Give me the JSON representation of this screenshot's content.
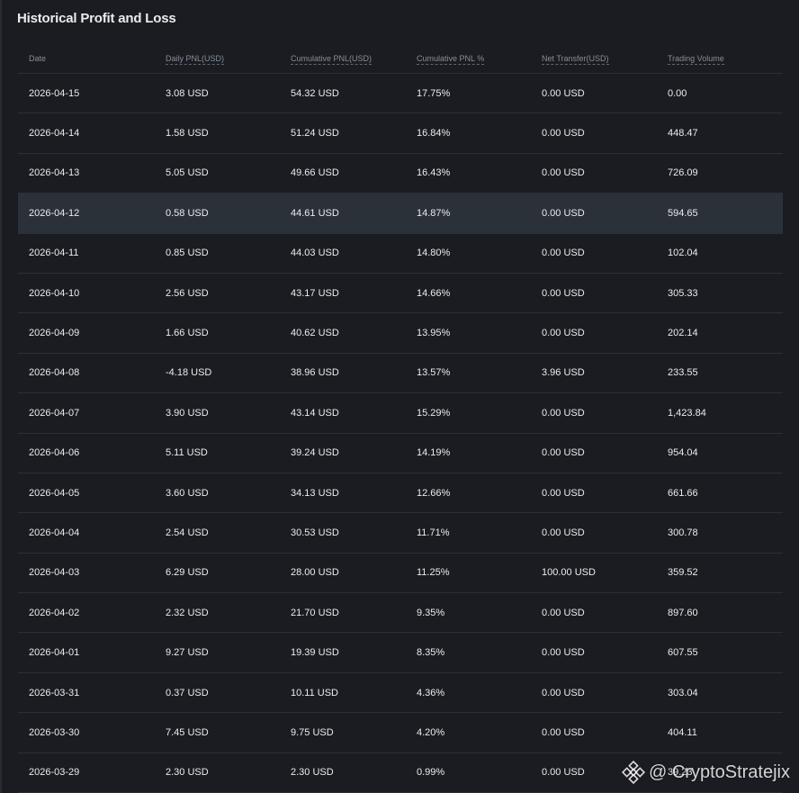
{
  "title": "Historical Profit and Loss",
  "columns": [
    "Date",
    "Daily PNL(USD)",
    "Cumulative PNL(USD)",
    "Cumulative PNL %",
    "Net Transfer(USD)",
    "Trading Volume"
  ],
  "rows": [
    [
      "2026-04-15",
      "3.08 USD",
      "54.32 USD",
      "17.75%",
      "0.00 USD",
      "0.00"
    ],
    [
      "2026-04-14",
      "1.58 USD",
      "51.24 USD",
      "16.84%",
      "0.00 USD",
      "448.47"
    ],
    [
      "2026-04-13",
      "5.05 USD",
      "49.66 USD",
      "16.43%",
      "0.00 USD",
      "726.09"
    ],
    [
      "2026-04-12",
      "0.58 USD",
      "44.61 USD",
      "14.87%",
      "0.00 USD",
      "594.65"
    ],
    [
      "2026-04-11",
      "0.85 USD",
      "44.03 USD",
      "14.80%",
      "0.00 USD",
      "102.04"
    ],
    [
      "2026-04-10",
      "2.56 USD",
      "43.17 USD",
      "14.66%",
      "0.00 USD",
      "305.33"
    ],
    [
      "2026-04-09",
      "1.66 USD",
      "40.62 USD",
      "13.95%",
      "0.00 USD",
      "202.14"
    ],
    [
      "2026-04-08",
      "-4.18 USD",
      "38.96 USD",
      "13.57%",
      "3.96 USD",
      "233.55"
    ],
    [
      "2026-04-07",
      "3.90 USD",
      "43.14 USD",
      "15.29%",
      "0.00 USD",
      "1,423.84"
    ],
    [
      "2026-04-06",
      "5.11 USD",
      "39.24 USD",
      "14.19%",
      "0.00 USD",
      "954.04"
    ],
    [
      "2026-04-05",
      "3.60 USD",
      "34.13 USD",
      "12.66%",
      "0.00 USD",
      "661.66"
    ],
    [
      "2026-04-04",
      "2.54 USD",
      "30.53 USD",
      "11.71%",
      "0.00 USD",
      "300.78"
    ],
    [
      "2026-04-03",
      "6.29 USD",
      "28.00 USD",
      "11.25%",
      "100.00 USD",
      "359.52"
    ],
    [
      "2026-04-02",
      "2.32 USD",
      "21.70 USD",
      "9.35%",
      "0.00 USD",
      "897.60"
    ],
    [
      "2026-04-01",
      "9.27 USD",
      "19.39 USD",
      "8.35%",
      "0.00 USD",
      "607.55"
    ],
    [
      "2026-03-31",
      "0.37 USD",
      "10.11 USD",
      "4.36%",
      "0.00 USD",
      "303.04"
    ],
    [
      "2026-03-30",
      "7.45 USD",
      "9.75 USD",
      "4.20%",
      "0.00 USD",
      "404.11"
    ],
    [
      "2026-03-29",
      "2.30 USD",
      "2.30 USD",
      "0.99%",
      "0.00 USD",
      "39.23"
    ]
  ],
  "watermark": {
    "text": "@ CryptoStratejix",
    "icon": "binance-logo-icon"
  },
  "colors": {
    "background": "#1b1c21",
    "text": "#eaecef",
    "muted": "#848e9c",
    "divider": "#2b2f36",
    "row_highlight": "#2b3139"
  }
}
